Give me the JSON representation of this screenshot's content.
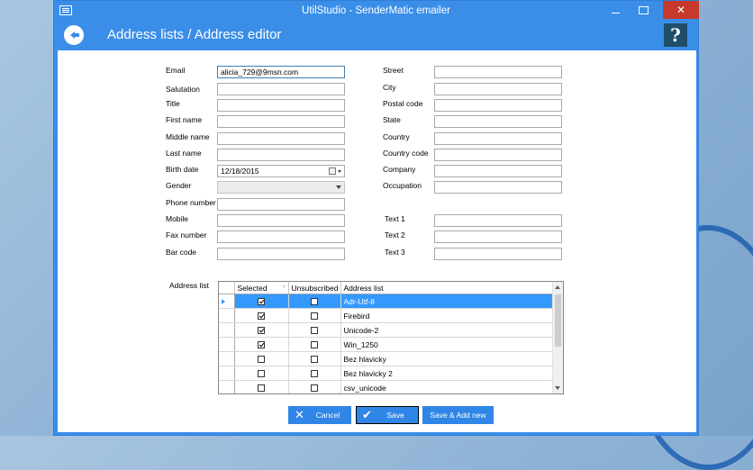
{
  "window": {
    "title": "UtilStudio - SenderMatic emailer"
  },
  "header": {
    "title": "Address lists / Address editor",
    "help_label": "?"
  },
  "left_fields": [
    {
      "label": "Email",
      "value": "alicia_729@9msn.com"
    },
    {
      "label": "Salutation",
      "value": ""
    },
    {
      "label": "Title",
      "value": ""
    },
    {
      "label": "First name",
      "value": ""
    },
    {
      "label": "Middle name",
      "value": ""
    },
    {
      "label": "Last name",
      "value": ""
    },
    {
      "label": "Birth date",
      "value": "12/18/2015"
    },
    {
      "label": "Gender",
      "value": ""
    },
    {
      "label": "Phone number",
      "value": ""
    },
    {
      "label": "Mobile",
      "value": ""
    },
    {
      "label": "Fax number",
      "value": ""
    },
    {
      "label": "Bar code",
      "value": ""
    }
  ],
  "right_fields": [
    {
      "label": "Street",
      "value": ""
    },
    {
      "label": "City",
      "value": ""
    },
    {
      "label": "Postal code",
      "value": ""
    },
    {
      "label": "State",
      "value": ""
    },
    {
      "label": "Country",
      "value": ""
    },
    {
      "label": "Country code",
      "value": ""
    },
    {
      "label": "Company",
      "value": ""
    },
    {
      "label": "Occupation",
      "value": ""
    },
    {
      "label": "Text 1",
      "value": ""
    },
    {
      "label": "Text 2",
      "value": ""
    },
    {
      "label": "Text 3",
      "value": ""
    }
  ],
  "address_list": {
    "label": "Address list",
    "columns": [
      "Selected",
      "Unsubscribed",
      "Address list"
    ],
    "rows": [
      {
        "selected": true,
        "unsubscribed": false,
        "name": "Adr-Utf-8",
        "current": true
      },
      {
        "selected": true,
        "unsubscribed": false,
        "name": "Firebird",
        "current": false
      },
      {
        "selected": true,
        "unsubscribed": false,
        "name": "Unicode-2",
        "current": false
      },
      {
        "selected": true,
        "unsubscribed": false,
        "name": "Win_1250",
        "current": false
      },
      {
        "selected": false,
        "unsubscribed": false,
        "name": "Bez hlavicky",
        "current": false
      },
      {
        "selected": false,
        "unsubscribed": false,
        "name": "Bez hlavicky 2",
        "current": false
      },
      {
        "selected": false,
        "unsubscribed": false,
        "name": "csv_unicode",
        "current": false
      }
    ]
  },
  "buttons": {
    "cancel": "Cancel",
    "save": "Save",
    "save_add": "Save & Add new"
  },
  "colors": {
    "accent": "#3a8ee8",
    "selection": "#3399ff",
    "help": "#1f4e6b",
    "close": "#c7392b"
  }
}
